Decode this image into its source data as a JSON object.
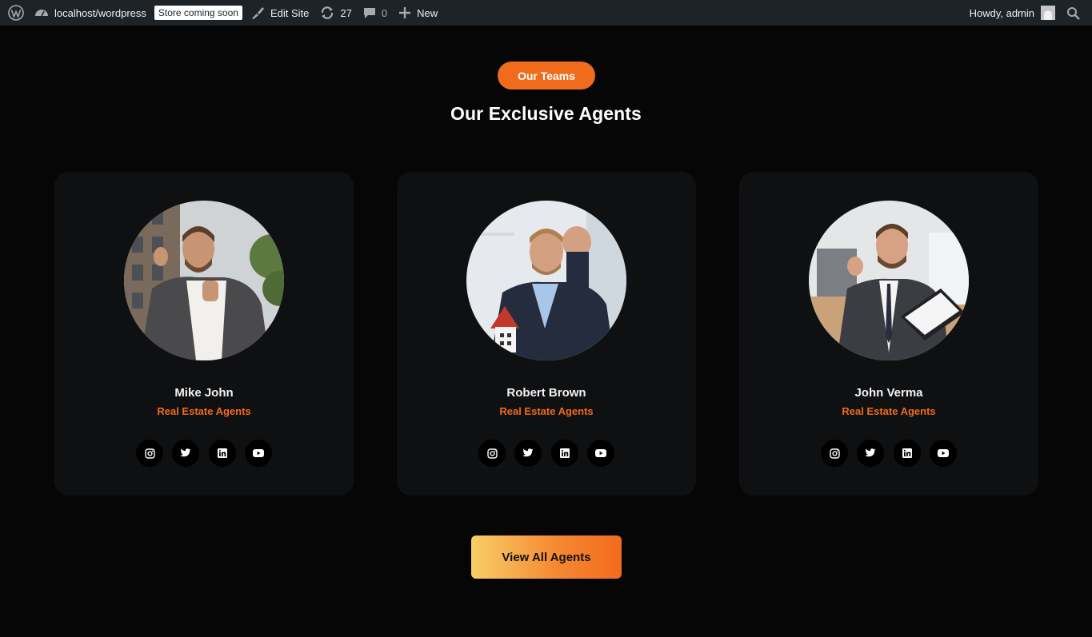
{
  "admin_bar": {
    "site_name": "localhost/wordpress",
    "store_badge": "Store coming soon",
    "edit_site": "Edit Site",
    "updates_count": "27",
    "comments_count": "0",
    "new_label": "New",
    "howdy": "Howdy, admin",
    "icons": [
      "wordpress-logo-icon",
      "dashboard-icon",
      "brush-icon",
      "updates-icon",
      "comments-icon",
      "plus-icon",
      "avatar",
      "search-icon"
    ]
  },
  "section": {
    "badge": "Our Teams",
    "title": "Our Exclusive Agents"
  },
  "agents": [
    {
      "name": "Mike John",
      "role": "Real Estate Agents",
      "photo": "agent-photo-mike-john",
      "socials": [
        "instagram-icon",
        "twitter-icon",
        "linkedin-icon",
        "youtube-icon"
      ]
    },
    {
      "name": "Robert Brown",
      "role": "Real Estate Agents",
      "photo": "agent-photo-robert-brown",
      "socials": [
        "instagram-icon",
        "twitter-icon",
        "linkedin-icon",
        "youtube-icon"
      ]
    },
    {
      "name": "John Verma",
      "role": "Real Estate Agents",
      "photo": "agent-photo-john-verma",
      "socials": [
        "instagram-icon",
        "twitter-icon",
        "linkedin-icon",
        "youtube-icon"
      ]
    }
  ],
  "cta": {
    "label": "View All Agents"
  },
  "colors": {
    "accent": "#f06b1c",
    "background": "#060607",
    "card": "#0f1012",
    "admin_bar": "#1d2327",
    "gradient_start": "#f8cf66",
    "gradient_end": "#f26b1d"
  }
}
